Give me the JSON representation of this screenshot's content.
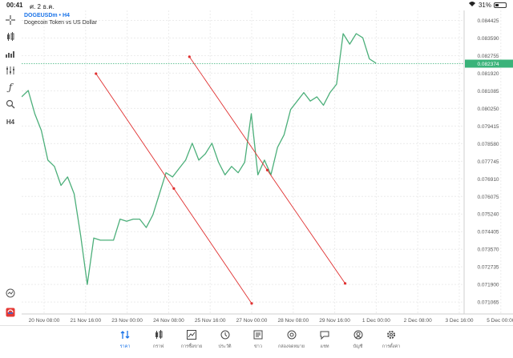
{
  "status": {
    "time": "00:41",
    "date": "ศ. 2 ธ.ค.",
    "battery": "31%",
    "battery_level": 0.31
  },
  "chart": {
    "symbol": "DOGEUSDm • H4",
    "description": "Dogecoin Token vs US Dollar",
    "price_labels": [
      "0.084425",
      "0.083590",
      "0.082755",
      "0.081920",
      "0.081085",
      "0.080250",
      "0.079415",
      "0.078580",
      "0.077745",
      "0.076910",
      "0.076075",
      "0.075240",
      "0.074405",
      "0.073570",
      "0.072735",
      "0.071900",
      "0.071065"
    ],
    "current_price": "0.082374",
    "time_labels": [
      "20 Nov 08:00",
      "21 Nov 16:00",
      "23 Nov 00:00",
      "24 Nov 08:00",
      "25 Nov 16:00",
      "27 Nov 00:00",
      "28 Nov 08:00",
      "29 Nov 16:00",
      "1 Dec 00:00",
      "2 Dec 08:00",
      "3 Dec 16:00",
      "5 Dec 00:00"
    ],
    "colors": {
      "line": "#4caf7a",
      "trend": "#e03030",
      "current": "#3ab37a",
      "accent": "#1a73e8"
    }
  },
  "chart_data": {
    "type": "line",
    "series": [
      {
        "values": [
          0.0808,
          0.0811,
          0.08,
          0.0792,
          0.0778,
          0.0775,
          0.0766,
          0.077,
          0.0762,
          0.0742,
          0.0719,
          0.0741,
          0.074,
          0.074,
          0.074,
          0.075,
          0.0749,
          0.075,
          0.075,
          0.0746,
          0.0752,
          0.0762,
          0.0772,
          0.077,
          0.0774,
          0.0778,
          0.0786,
          0.0778,
          0.0781,
          0.0786,
          0.0777,
          0.0771,
          0.0775,
          0.0772,
          0.0777,
          0.08,
          0.0771,
          0.0778,
          0.0771,
          0.0784,
          0.079,
          0.0802,
          0.0806,
          0.081,
          0.0806,
          0.0808,
          0.0804,
          0.081,
          0.0814,
          0.0838,
          0.0833,
          0.0838,
          0.0836,
          0.0826,
          0.0824
        ]
      }
    ],
    "trendlines": [
      {
        "from": [
          "22 Nov",
          0.0819
        ],
        "to": [
          "27 Nov",
          0.071
        ]
      },
      {
        "from": [
          "25 Nov",
          0.0827
        ],
        "to": [
          "30 Nov",
          0.07195
        ]
      }
    ],
    "ylim": [
      0.0705,
      0.0849
    ],
    "grid": true
  },
  "toolbar": {
    "icons": [
      "crosshair-icon",
      "candle-icon",
      "indicator-icon",
      "objects-icon",
      "function-icon",
      "search-chart-icon",
      "timeframe-icon",
      "tradeline-icon",
      "logo-icon"
    ],
    "timeframe": "H4"
  },
  "nav": {
    "items": [
      {
        "label": "ราคา",
        "icon": "quotes-icon",
        "active": true
      },
      {
        "label": "กราฟ",
        "icon": "chart-icon"
      },
      {
        "label": "การซื้อขาย",
        "icon": "trade-icon"
      },
      {
        "label": "ประวัติ",
        "icon": "history-icon"
      },
      {
        "label": "ข่าว",
        "icon": "news-icon"
      },
      {
        "label": "กล่องจดหมาย",
        "icon": "mail-icon"
      },
      {
        "label": "แชท",
        "icon": "chat-icon"
      },
      {
        "label": "บัญชี",
        "icon": "account-icon"
      },
      {
        "label": "การตั้งค่า",
        "icon": "settings-icon"
      }
    ]
  }
}
